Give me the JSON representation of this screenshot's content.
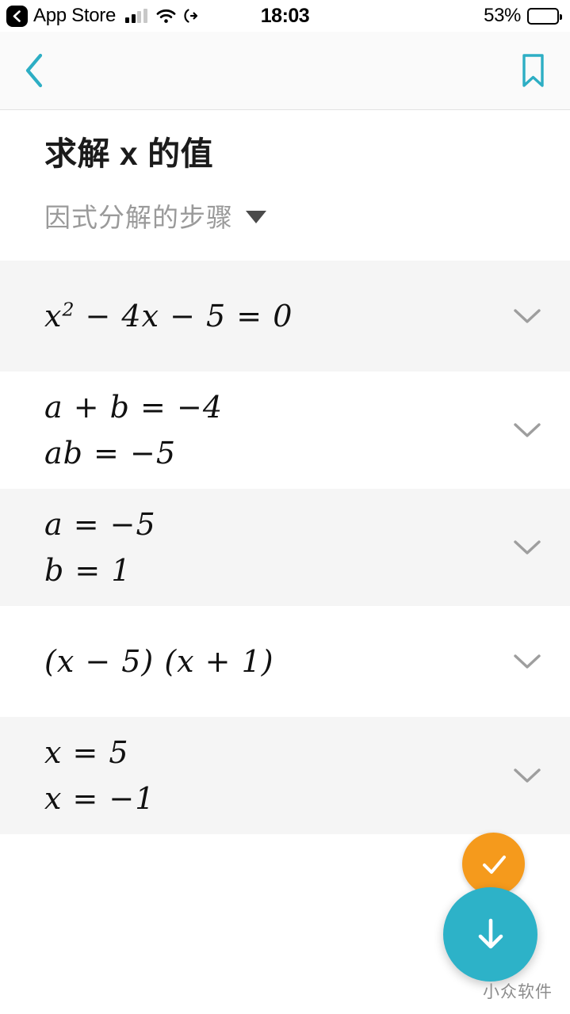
{
  "status_bar": {
    "back_app_label": "App Store",
    "back_icon": "chevron-left-icon",
    "signal_icon": "cellular-signal-icon",
    "wifi_icon": "wifi-icon",
    "location_icon": "location-arrow-icon",
    "time": "18:03",
    "battery_percent": "53%",
    "battery_level": 55
  },
  "nav_bar": {
    "back_icon": "chevron-left-icon",
    "bookmark_icon": "bookmark-icon",
    "accent_color": "#2daec4"
  },
  "header": {
    "title_prefix": "求解 ",
    "title_var": "x",
    "title_suffix": " 的值",
    "subtitle": "因式分解的步骤",
    "subtitle_caret_icon": "caret-down-icon"
  },
  "steps": [
    {
      "shaded": true,
      "lines": [
        "x² − 4x − 5 = 0"
      ],
      "expand_icon": "chevron-down-icon"
    },
    {
      "shaded": false,
      "lines": [
        "a + b = −4",
        "ab = −5"
      ],
      "expand_icon": "chevron-down-icon"
    },
    {
      "shaded": true,
      "lines": [
        "a = −5",
        "b = 1"
      ],
      "expand_icon": "chevron-down-icon"
    },
    {
      "shaded": false,
      "lines": [
        "(x − 5) (x + 1)"
      ],
      "expand_icon": "chevron-down-icon"
    },
    {
      "shaded": true,
      "lines": [
        "x = 5",
        "x = −1"
      ],
      "expand_icon": "chevron-down-icon"
    }
  ],
  "fabs": {
    "check": {
      "icon": "check-icon",
      "color": "#f59a1c"
    },
    "download": {
      "icon": "arrow-down-icon",
      "color": "#2db2c8"
    }
  },
  "watermark": "小众软件"
}
